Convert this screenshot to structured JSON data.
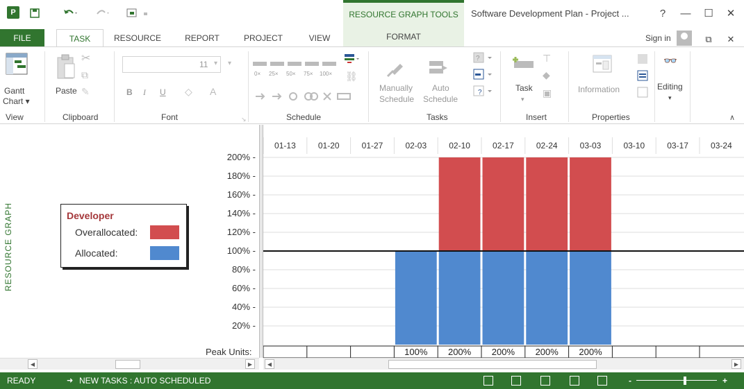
{
  "app": {
    "icon_text": "P",
    "title": "Software Development Plan - Project ...",
    "contextual_tab": "RESOURCE GRAPH TOOLS",
    "help": "?",
    "min": "—",
    "max": "☐",
    "close": "✕"
  },
  "tabs": {
    "file": "FILE",
    "task": "TASK",
    "resource": "RESOURCE",
    "report": "REPORT",
    "project": "PROJECT",
    "view": "VIEW",
    "format": "FORMAT",
    "sign_in": "Sign in"
  },
  "ribbon": {
    "groups": {
      "view": "View",
      "clipboard": "Clipboard",
      "font": "Font",
      "schedule": "Schedule",
      "tasks": "Tasks",
      "insert": "Insert",
      "properties": "Properties"
    },
    "gantt_chart": "Gantt",
    "gantt_chart2": "Chart ▾",
    "paste": "Paste",
    "font_size": "11",
    "bold": "B",
    "italic": "I",
    "underline": "U",
    "pct_labels": [
      "0×",
      "25×",
      "50×",
      "75×",
      "100×"
    ],
    "manually": "Manually",
    "schedule1": "Schedule",
    "auto": "Auto",
    "schedule2": "Schedule",
    "task": "Task",
    "information": "Information",
    "editing": "Editing"
  },
  "left_panel": {
    "vertical_label": "RESOURCE GRAPH",
    "legend_title": "Developer",
    "overallocated_label": "Overallocated:",
    "allocated_label": "Allocated:",
    "peak_units_label": "Peak Units:"
  },
  "colors": {
    "overallocated": "#d24d4f",
    "allocated": "#5089cf",
    "accent": "#31752f"
  },
  "chart_data": {
    "type": "bar",
    "categories": [
      "01-13",
      "01-20",
      "01-27",
      "02-03",
      "02-10",
      "02-17",
      "02-24",
      "03-03",
      "03-10",
      "03-17",
      "03-24"
    ],
    "series": [
      {
        "name": "Allocated",
        "values": [
          0,
          0,
          0,
          100,
          100,
          100,
          100,
          100,
          0,
          0,
          0
        ]
      },
      {
        "name": "Overallocated",
        "values": [
          0,
          0,
          0,
          0,
          100,
          100,
          100,
          100,
          0,
          0,
          0
        ]
      }
    ],
    "peak_units": [
      "",
      "",
      "",
      "100%",
      "200%",
      "200%",
      "200%",
      "200%",
      "",
      "",
      ""
    ],
    "y_ticks": [
      "200%",
      "180%",
      "160%",
      "140%",
      "120%",
      "100%",
      "80%",
      "60%",
      "40%",
      "20%"
    ],
    "ylim": [
      0,
      200
    ],
    "max_units_line": 100,
    "stacked": true,
    "grid": true
  },
  "status": {
    "ready": "READY",
    "new_tasks": "NEW TASKS : AUTO SCHEDULED",
    "zoom_minus": "-",
    "zoom_plus": "+"
  }
}
